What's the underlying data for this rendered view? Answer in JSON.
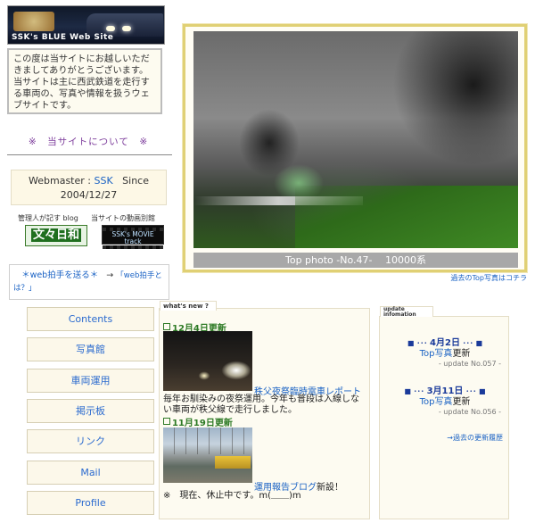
{
  "logo": {
    "text": "SSK's BLUE Web Site"
  },
  "intro": {
    "text": "この度は当サイトにお越しいただきましてありがとうございます。 当サイトは主に西武鉄道を走行する車両の、写真や情報を扱うウェブサイトです。"
  },
  "about": {
    "label": "※　当サイトについて　※"
  },
  "webmaster": {
    "prefix": "Webmaster : ",
    "name": "SSK",
    "since_label": "Since",
    "since_date": "2004/12/27"
  },
  "banners": {
    "blog_caption": "管理人が記す blog",
    "blog_title": "文々日和",
    "movie_caption": "当サイトの動画別館",
    "movie_title": "SSK's MOVIE track"
  },
  "clap": {
    "send": "＊web拍手を送る＊",
    "arrow": "→",
    "what": "「web拍手とは？」"
  },
  "nav": [
    {
      "label": "Contents"
    },
    {
      "label": "写真館"
    },
    {
      "label": "車両運用"
    },
    {
      "label": "掲示板"
    },
    {
      "label": "リンク"
    },
    {
      "label": "Mail"
    },
    {
      "label": "Profile"
    }
  ],
  "photo": {
    "caption": "Top photo -No.47-　 10000系"
  },
  "past_top": {
    "label": "過去のTop写真はコチラ"
  },
  "news": {
    "tab": "what's new ?",
    "items": [
      {
        "date": "12月4日更新",
        "link": "秩父夜祭臨時電車レポート",
        "text": "毎年お馴染みの夜祭運用。今年も普段は入線しない車両が秩父線で走行しました。"
      },
      {
        "date": "11月19日更新",
        "link": "運用報告ブログ",
        "link_suffix": "新設！",
        "text": "※　現在、休止中です。m(＿＿)m"
      }
    ]
  },
  "updates": {
    "tab_line1": "update",
    "tab_line2": "infomation",
    "items": [
      {
        "date": "4月2日",
        "link": "Top写真",
        "suffix": "更新",
        "no": "- update No.057 -"
      },
      {
        "date": "3月11日",
        "link": "Top写真",
        "suffix": "更新",
        "no": "- update No.056 -"
      }
    ],
    "history": "→過去の更新履歴"
  }
}
